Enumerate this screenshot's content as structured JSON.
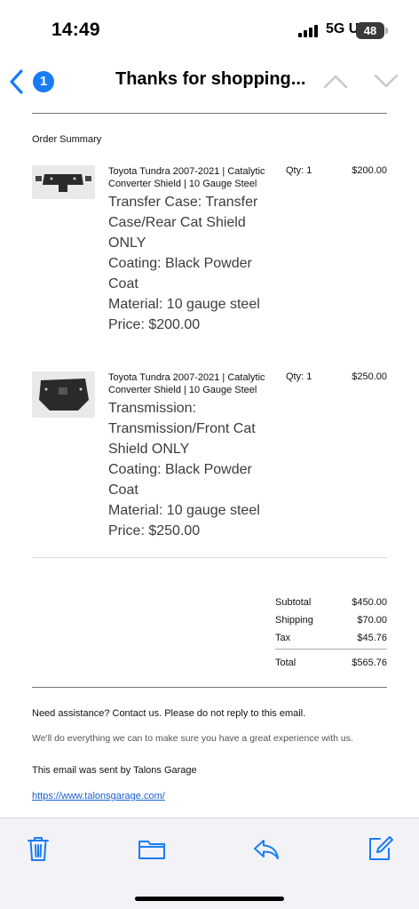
{
  "status": {
    "time": "14:49",
    "network": "5G UC",
    "battery": "48"
  },
  "nav": {
    "unread_count": "1",
    "title": "Thanks for shopping..."
  },
  "email": {
    "order_summary_label": "Order Summary",
    "items": [
      {
        "name": "Toyota Tundra 2007-2021 | Catalytic Converter Shield | 10 Gauge Steel",
        "qty": "Qty: 1",
        "price": "$200.00",
        "options": [
          "Transfer Case: Transfer Case/Rear Cat Shield ONLY",
          "Coating: Black Powder Coat",
          "Material: 10 gauge steel",
          "Price: $200.00"
        ]
      },
      {
        "name": "Toyota Tundra 2007-2021 | Catalytic Converter Shield | 10 Gauge Steel",
        "qty": "Qty: 1",
        "price": "$250.00",
        "options": [
          "Transmission: Transmission/Front Cat Shield ONLY",
          "Coating: Black Powder Coat",
          "Material: 10 gauge steel",
          "Price: $250.00"
        ]
      }
    ],
    "totals": {
      "subtotal_label": "Subtotal",
      "subtotal": "$450.00",
      "shipping_label": "Shipping",
      "shipping": "$70.00",
      "tax_label": "Tax",
      "tax": "$45.76",
      "total_label": "Total",
      "total": "$565.76"
    },
    "footer": {
      "assistance": "Need assistance? Contact us. Please do not reply to this email.",
      "promise": "We'll do everything we can to make sure you have a great experience with us.",
      "sent_by": "This email was sent by Talons Garage",
      "link": "https://www.talonsgarage.com/"
    }
  },
  "toolbar": {
    "icons": [
      "trash-icon",
      "folder-icon",
      "reply-icon",
      "compose-icon"
    ]
  },
  "colors": {
    "accent": "#1a7cf5",
    "link": "#1a5fd0",
    "toolbar_bg": "#f2f2f7"
  }
}
